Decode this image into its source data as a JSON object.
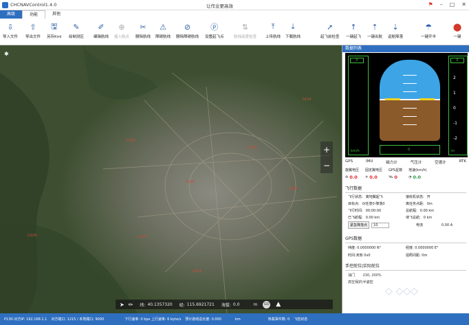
{
  "window": {
    "app_title": "CHCNAVControl1.4.0",
    "center_title": "让作业更高效",
    "controls": [
      "flag-icon",
      "minimize",
      "maximize",
      "close"
    ]
  },
  "ribbon_tabs": [
    {
      "label": "高级",
      "state": "highlighted"
    },
    {
      "label": "功能",
      "state": "selected"
    },
    {
      "label": "其他",
      "state": "normal"
    }
  ],
  "toolbar": {
    "left": [
      {
        "label": "导入文件",
        "icon": "import-icon"
      },
      {
        "label": "导出文件",
        "icon": "export-icon"
      },
      {
        "label": "另存Kml",
        "icon": "save-kml-icon"
      },
      {
        "label": "绘制测区",
        "icon": "draw-area-icon"
      },
      {
        "label": "编辑航线",
        "icon": "edit-route-icon"
      },
      {
        "label": "插入航点",
        "icon": "insert-waypoint-icon",
        "disabled": true
      },
      {
        "label": "删除航线",
        "icon": "delete-route-icon"
      },
      {
        "label": "障碍航线",
        "icon": "obstacle-route-icon"
      },
      {
        "label": "删除障碍航线",
        "icon": "delete-obstacle-icon"
      },
      {
        "label": "设置起飞点",
        "icon": "set-takeoff-icon"
      },
      {
        "label": "航线高度检查",
        "icon": "height-check-icon",
        "disabled": true
      },
      {
        "label": "上传航线",
        "icon": "upload-route-icon"
      },
      {
        "label": "下载航线",
        "icon": "download-route-icon"
      }
    ],
    "right": [
      {
        "label": "起飞前检查",
        "icon": "preflight-check-icon"
      },
      {
        "label": "一键起飞",
        "icon": "takeoff-icon"
      },
      {
        "label": "一键出航",
        "icon": "depart-icon"
      },
      {
        "label": "返航降落",
        "icon": "return-land-icon"
      },
      {
        "label": "一键开伞",
        "icon": "parachute-icon"
      },
      {
        "label": "一键",
        "icon": "one-key-red-icon"
      }
    ]
  },
  "map": {
    "zoom_in": "+",
    "zoom_out": "−",
    "coord_bar": {
      "lat_label": "纬:",
      "lat": "40.1357320",
      "lon_label": "经:",
      "lon": "115.6921721",
      "alt_label": "海拔:",
      "alt": "0.0",
      "unit": "m",
      "circle_btn": "GO"
    }
  },
  "panel": {
    "title": "数据列表",
    "airspeed": {
      "value": "0",
      "unit": "km/h"
    },
    "altitude": {
      "value": "0",
      "unit": "m",
      "ticks": [
        "2",
        "1",
        "0",
        "-1",
        "-2"
      ]
    },
    "heading": {
      "value": "0"
    },
    "sensors": [
      "GPS",
      "IMU",
      "磁力计",
      "气压计",
      "空速计",
      "RTK"
    ],
    "status": [
      {
        "label": "旋翼电压",
        "value": "0.0",
        "icon": "rotor-icon",
        "color": "red"
      },
      {
        "label": "固定翼电压",
        "value": "0.0",
        "icon": "plane-icon",
        "color": "red"
      },
      {
        "label": "GPS星数",
        "value": "0",
        "icon": "satellite-icon",
        "color": "red"
      },
      {
        "label": "地速(km/h)",
        "value": "0.0",
        "icon": "speedometer-icon",
        "color": "green"
      }
    ],
    "flight_data": {
      "title": "飞行数据",
      "rows": [
        {
          "l1": "飞行状态:",
          "v1": "离地翼起飞",
          "l2": "接收机状态:",
          "v2": "开"
        },
        {
          "l1": "目标点:",
          "v1": "0/任意0·降落0",
          "l2": "离任务点距:",
          "v2": "0m"
        },
        {
          "l1": "飞行时间:",
          "v1": "00:00:00",
          "l2": "总航程:",
          "v2": "0.00 km"
        },
        {
          "l1": "已飞航程:",
          "v1": "0.00 km",
          "l2": "待飞总航:",
          "v2": "0 km"
        }
      ],
      "emergency_btn": "紧急降落点",
      "emergency_value": "10",
      "current_label": "电流",
      "current_value": "0.00 A"
    },
    "gps_data": {
      "title": "GPS数据",
      "rows": [
        {
          "l1": "纬度:",
          "v1": "0.0000000 N°",
          "l2": "经度:",
          "v2": "0.0000000 E°"
        },
        {
          "l1": "时间:未知",
          "v1": "0x0",
          "l2": "拍照间距:",
          "v2": "0m"
        }
      ]
    },
    "remote": {
      "title": "手控舵位|实际舵位",
      "throttle_label": "油门",
      "throttle_value": "230, 200%",
      "extra": "高空保护|半姿控"
    }
  },
  "statusbar": {
    "items": [
      "P130-对方IP: 192.168.1.1",
      "对方端口: 1215 / 本地端口: 9000",
      "下行速率: 0 bps 上行速率: 6 byte/s",
      "预计航线总长度: 0.000",
      "km",
      "热载事件数: 0",
      "飞控状态"
    ]
  }
}
